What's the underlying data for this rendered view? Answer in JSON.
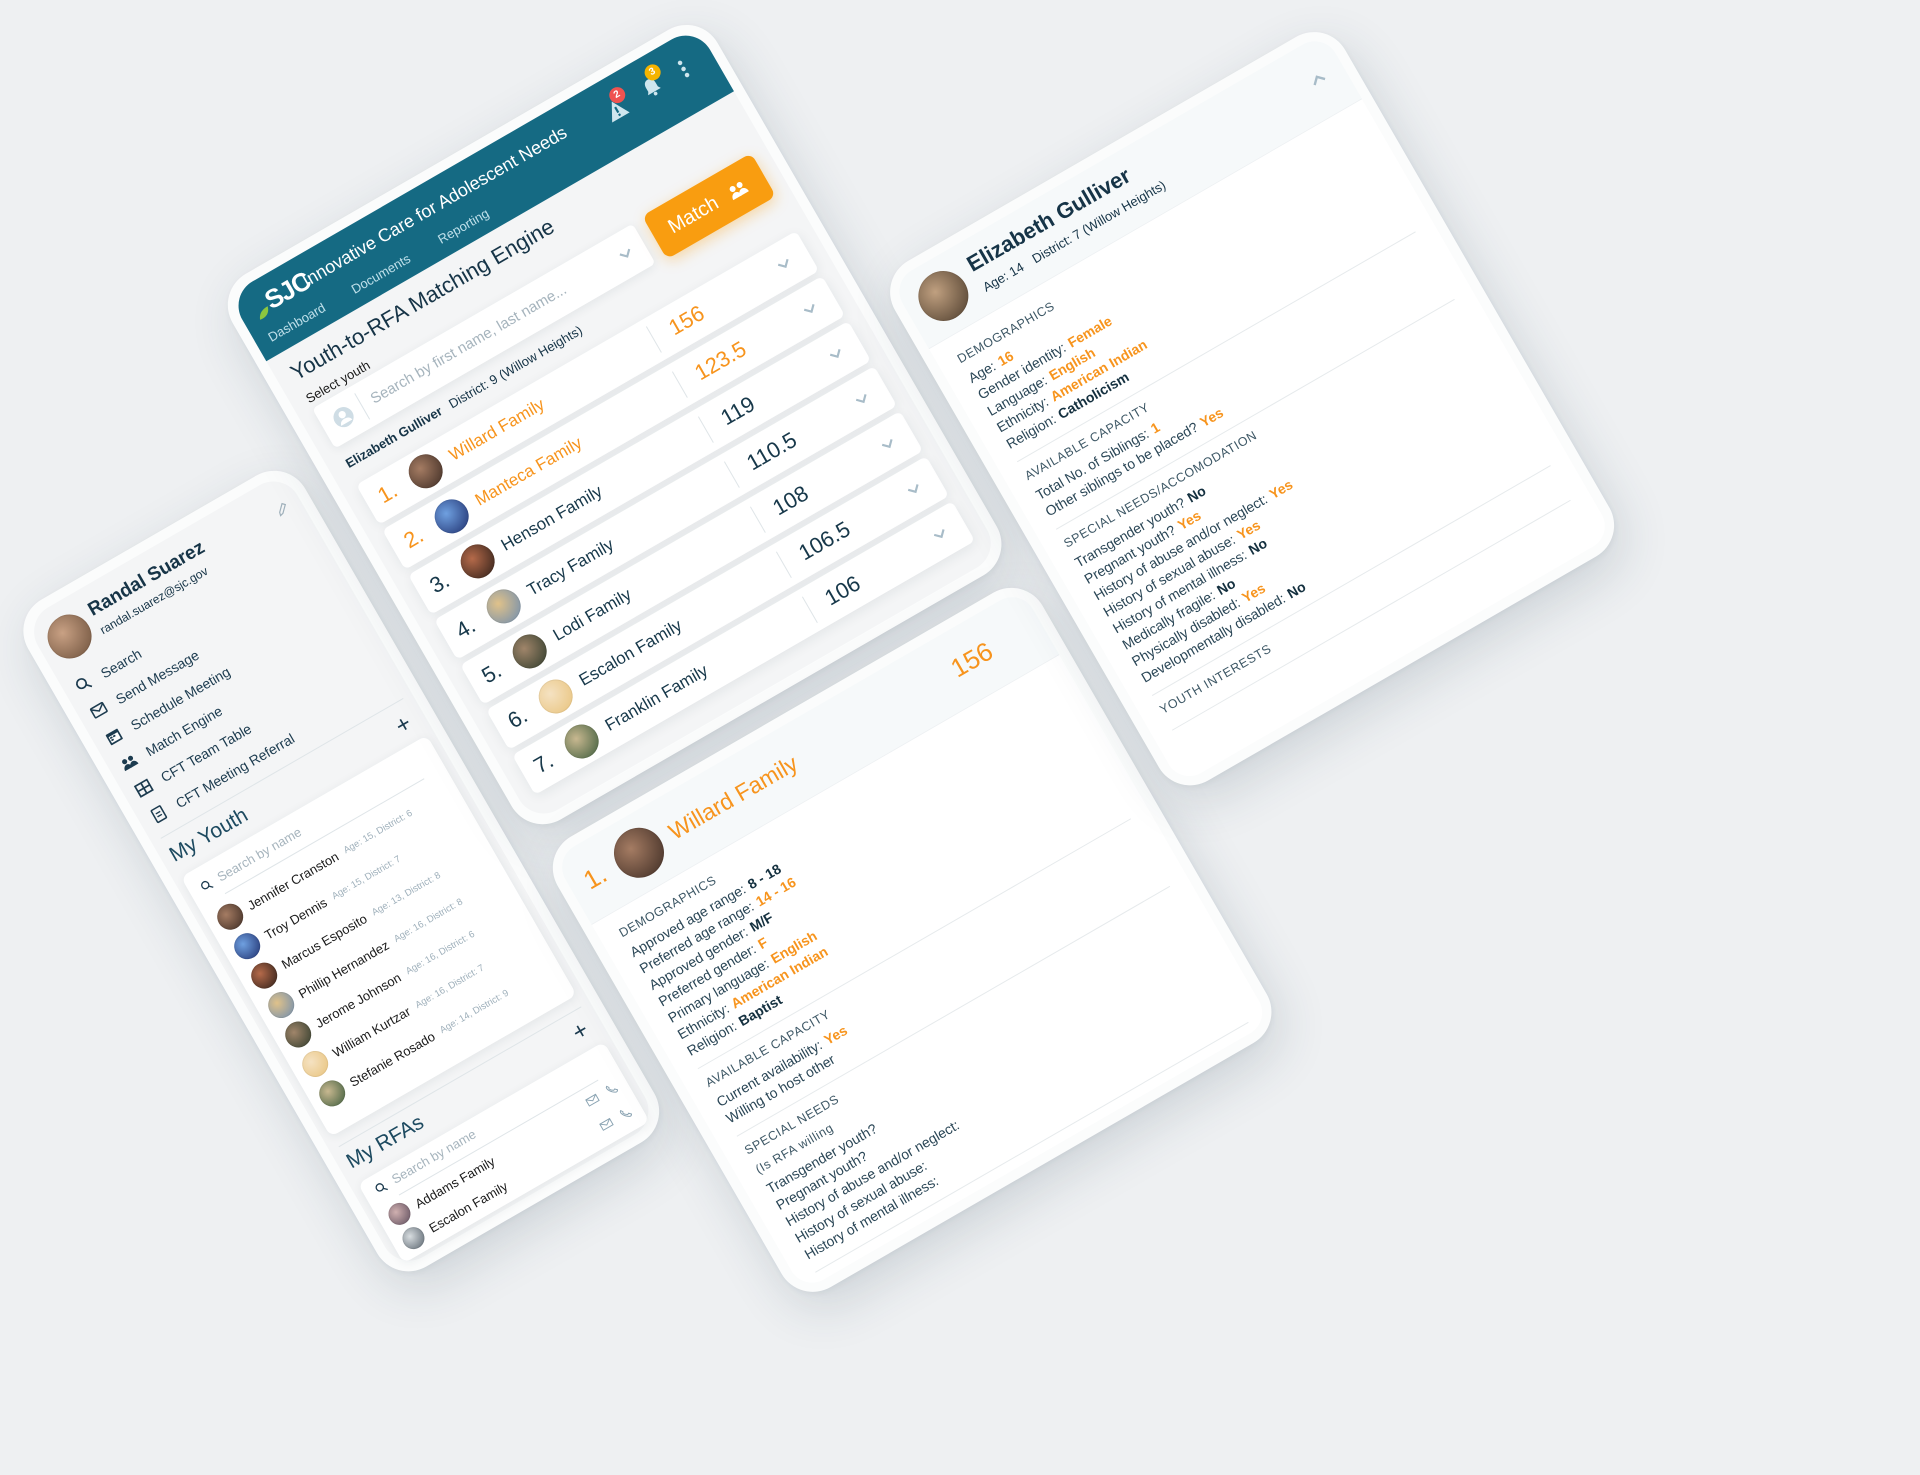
{
  "app": {
    "brand_logo": "SJC",
    "title": "Innovative Care for Adolescent Needs",
    "tabs": [
      "Dashboard",
      "Documents",
      "Reporting"
    ],
    "alerts_badge": "2",
    "notifications_badge": "3"
  },
  "user": {
    "name": "Randal Suarez",
    "email": "randal.suarez@sjc.gov"
  },
  "nav": [
    {
      "label": "Search",
      "icon": "search-icon"
    },
    {
      "label": "Send Message",
      "icon": "mail-icon"
    },
    {
      "label": "Schedule Meeting",
      "icon": "calendar-icon"
    },
    {
      "label": "Match Engine",
      "icon": "people-icon"
    },
    {
      "label": "CFT Team Table",
      "icon": "table-icon"
    },
    {
      "label": "CFT Meeting Referral",
      "icon": "document-icon"
    }
  ],
  "my_youth": {
    "title": "My Youth",
    "search_placeholder": "Search by name",
    "items": [
      {
        "name": "Jennifer Cranston",
        "meta": "Age: 15, District: 6"
      },
      {
        "name": "Troy Dennis",
        "meta": "Age: 15, District: 7"
      },
      {
        "name": "Marcus Esposito",
        "meta": "Age: 13, District: 8"
      },
      {
        "name": "Phillip Hernandez",
        "meta": "Age: 16, District: 8"
      },
      {
        "name": "Jerome Johnson",
        "meta": "Age: 16, District: 6"
      },
      {
        "name": "William Kurtzar",
        "meta": "Age: 16, District: 7"
      },
      {
        "name": "Stefanie Rosado",
        "meta": "Age: 14, District: 9"
      }
    ]
  },
  "my_rfas": {
    "title": "My RFAs",
    "search_placeholder": "Search by name",
    "items": [
      {
        "name": "Addams Family"
      },
      {
        "name": "Escalon Family"
      }
    ]
  },
  "page": {
    "title": "Youth-to-RFA Matching Engine",
    "select_label": "Select youth",
    "search_placeholder": "Search by first name, last name...",
    "match_label": "Match"
  },
  "youth": {
    "name": "Elizabeth Gulliver",
    "age": "Age: 14",
    "district": "District: 7 (Willow Heights)",
    "district_alt": "District: 9 (Willow Heights)",
    "sections": [
      {
        "title": "Demographics",
        "items": [
          {
            "label": "Age:",
            "value": "16",
            "highlight": true
          },
          {
            "label": "Gender identity:",
            "value": "Female",
            "highlight": true
          },
          {
            "label": "Language:",
            "value": "English",
            "highlight": true
          },
          {
            "label": "Ethnicity:",
            "value": "American Indian",
            "highlight": true
          },
          {
            "label": "Religion:",
            "value": "Catholicism",
            "highlight": false
          }
        ]
      },
      {
        "title": "Available Capacity",
        "items": [
          {
            "label": "Total No. of Siblings:",
            "value": "1",
            "highlight": true
          },
          {
            "label": "Other siblings to be placed?",
            "value": "Yes",
            "highlight": true
          }
        ]
      },
      {
        "title": "Special Needs/Accomodation",
        "items": [
          {
            "label": "Transgender youth?",
            "value": "No",
            "highlight": false
          },
          {
            "label": "Pregnant youth?",
            "value": "Yes",
            "highlight": true
          },
          {
            "label": "History of abuse and/or neglect:",
            "value": "Yes",
            "highlight": true
          },
          {
            "label": "History of sexual abuse:",
            "value": "Yes",
            "highlight": true
          },
          {
            "label": "History of mental illness:",
            "value": "No",
            "highlight": false
          },
          {
            "label": "Medically fragile:",
            "value": "No",
            "highlight": false
          },
          {
            "label": "Physically disabled:",
            "value": "Yes",
            "highlight": true
          },
          {
            "label": "Developmentally disabled:",
            "value": "No",
            "highlight": false
          }
        ]
      },
      {
        "title": "Youth Interests",
        "items": []
      }
    ]
  },
  "matches": [
    {
      "rank": "1.",
      "name": "Willard Family",
      "score": "156"
    },
    {
      "rank": "2.",
      "name": "Manteca Family",
      "score": "123.5"
    },
    {
      "rank": "3.",
      "name": "Henson Family",
      "score": "119"
    },
    {
      "rank": "4.",
      "name": "Tracy Family",
      "score": "110.5"
    },
    {
      "rank": "5.",
      "name": "Lodi Family",
      "score": "108"
    },
    {
      "rank": "6.",
      "name": "Escalon Family",
      "score": "106.5"
    },
    {
      "rank": "7.",
      "name": "Franklin Family",
      "score": "106"
    }
  ],
  "top_match_detail": {
    "sections": [
      {
        "title": "Demographics",
        "items": [
          {
            "label": "Approved age range:",
            "value": "8 - 18",
            "highlight": false
          },
          {
            "label": "Preferred age range:",
            "value": "14 - 16",
            "highlight": true
          },
          {
            "label": "Approved gender:",
            "value": "M/F",
            "highlight": false
          },
          {
            "label": "Preferred gender:",
            "value": "F",
            "highlight": true
          },
          {
            "label": "Primary language:",
            "value": "English",
            "highlight": true
          },
          {
            "label": "Ethnicity:",
            "value": "American Indian",
            "highlight": true
          },
          {
            "label": "Religion:",
            "value": "Baptist",
            "highlight": false
          }
        ]
      },
      {
        "title": "Available Capacity",
        "items": [
          {
            "label": "Current availability:",
            "value": "Yes",
            "highlight": true
          },
          {
            "label": "Willing to host other",
            "value": "",
            "highlight": false
          }
        ]
      },
      {
        "title": "Special Needs",
        "subtitle": "(Is RFA willing",
        "items": [
          {
            "label": "Transgender youth?",
            "value": "",
            "highlight": false
          },
          {
            "label": "Pregnant youth?",
            "value": "",
            "highlight": false
          },
          {
            "label": "History of abuse and/or neglect:",
            "value": "",
            "highlight": false
          },
          {
            "label": "History of sexual abuse:",
            "value": "",
            "highlight": false
          },
          {
            "label": "History of mental illness:",
            "value": "",
            "highlight": false
          }
        ]
      }
    ]
  },
  "colors": {
    "header": "#156a83",
    "accent": "#f7941d",
    "button": "#f99d10",
    "text": "#163447",
    "alert_badge": "#ef5350",
    "notify_badge": "#f5b400"
  }
}
